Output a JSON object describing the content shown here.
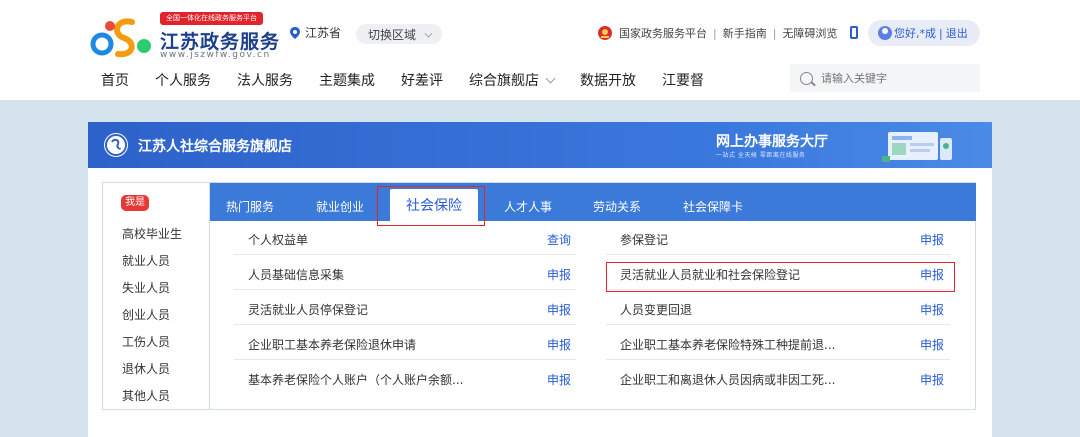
{
  "header": {
    "badge": "全国一体化在线政务服务平台",
    "site_title": "江苏政务服务",
    "site_url": "www.jszwfw.gov.cn",
    "region": "江苏省",
    "switch_region": "切换区域",
    "links": [
      "国家政务服务平台",
      "新手指南",
      "无障碍浏览"
    ],
    "user_greeting": "您好,*成",
    "logout": "退出",
    "nav": [
      "首页",
      "个人服务",
      "法人服务",
      "主题集成",
      "好差评",
      "综合旗舰店",
      "数据开放",
      "江要督"
    ],
    "search_placeholder": "请输入关键字"
  },
  "banner": {
    "title": "江苏人社综合服务旗舰店",
    "hall_title": "网上办事服务大厅",
    "slogan": "一站式 全天候   零距离在线服务"
  },
  "sidebar": {
    "badge": "我是",
    "categories": [
      "高校毕业生",
      "就业人员",
      "失业人员",
      "创业人员",
      "工伤人员",
      "退休人员",
      "其他人员"
    ]
  },
  "tabs": [
    {
      "label": "热门服务",
      "active": false
    },
    {
      "label": "就业创业",
      "active": false
    },
    {
      "label": "社会保险",
      "active": true
    },
    {
      "label": "人才人事",
      "active": false
    },
    {
      "label": "劳动关系",
      "active": false
    },
    {
      "label": "社会保障卡",
      "active": false
    }
  ],
  "services": [
    {
      "name": "个人权益单",
      "action": "查询"
    },
    {
      "name": "参保登记",
      "action": "申报"
    },
    {
      "name": "人员基础信息采集",
      "action": "申报"
    },
    {
      "name": "灵活就业人员就业和社会保险登记",
      "action": "申报"
    },
    {
      "name": "灵活就业人员停保登记",
      "action": "申报"
    },
    {
      "name": "人员变更回退",
      "action": "申报"
    },
    {
      "name": "企业职工基本养老保险退休申请",
      "action": "申报"
    },
    {
      "name": "企业职工基本养老保险特殊工种提前退...",
      "action": "申报"
    },
    {
      "name": "基本养老保险个人账户（个人账户余额...",
      "action": "申报"
    },
    {
      "name": "企业职工和离退休人员因病或非因工死...",
      "action": "申报"
    }
  ],
  "colors": {
    "primary_blue": "#3b7ad8",
    "link_blue": "#2a5cd6",
    "highlight_red": "#e0262d",
    "page_bg": "#d5e3ee"
  }
}
